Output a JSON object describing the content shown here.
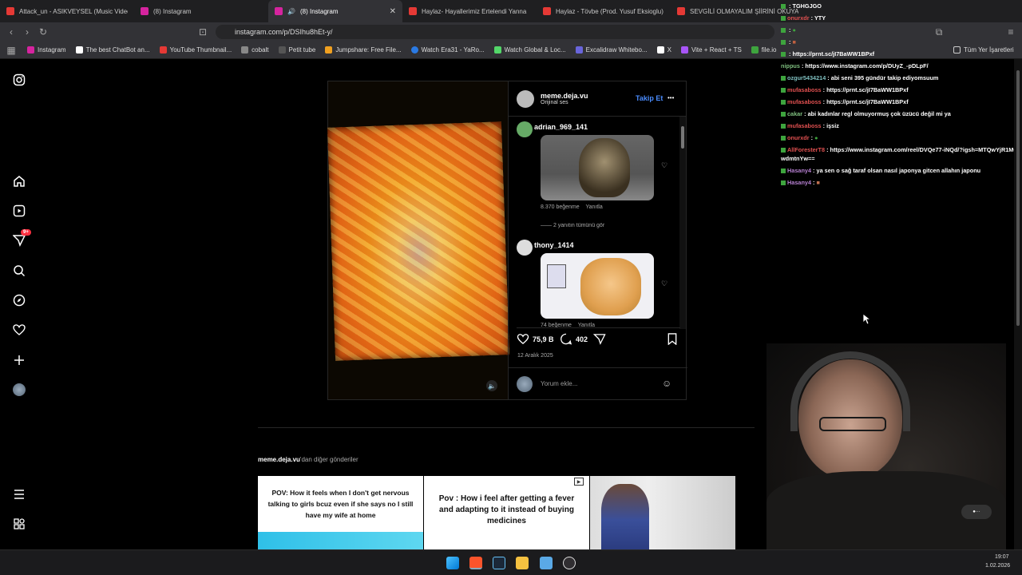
{
  "browser": {
    "tabs": [
      {
        "label": "Attack_un - ASIKVEYSEL (Music Video)",
        "color": "#e53935"
      },
      {
        "label": "(8) Instagram",
        "color": "#d6249f"
      },
      {
        "label": "(8) Instagram",
        "color": "#d6249f",
        "active": true
      },
      {
        "label": "Haylaz- Hayallerimiz Ertelendi Yanna",
        "color": "#e53935"
      },
      {
        "label": "Haylaz - Tövbe (Prod. Yusuf Eksioglu)",
        "color": "#e53935"
      },
      {
        "label": "SEVGİLİ OLMAYALIM ŞİİRİNİ OKUYAN",
        "color": "#e53935"
      }
    ],
    "url": "instagram.com/p/DSIhu8hEt-y/",
    "bookmarks": [
      {
        "label": "Instagram",
        "color": "#d6249f"
      },
      {
        "label": "The best ChatBot an...",
        "color": "#ffffff"
      },
      {
        "label": "YouTube Thumbnail...",
        "color": "#e53935"
      },
      {
        "label": "cobalt",
        "color": "#888888"
      },
      {
        "label": "Petit tube",
        "color": "#555555"
      },
      {
        "label": "Jumpshare: Free File...",
        "color": "#f0a020"
      },
      {
        "label": "Watch Era31 - YaRo...",
        "color": "#2a7ae4"
      },
      {
        "label": "Watch Global & Loc...",
        "color": "#53d769"
      },
      {
        "label": "Excalidraw Whitebo...",
        "color": "#6965db"
      },
      {
        "label": "X",
        "color": "#ffffff"
      },
      {
        "label": "Vite + React + TS",
        "color": "#a855f7"
      },
      {
        "label": "file.io",
        "color": "#3ea43e"
      }
    ],
    "all_bookmarks": "Tüm Yer İşaretleri"
  },
  "sidebar": {
    "notification_badge": "9+"
  },
  "post": {
    "username": "meme.deja.vu",
    "audio": "Orijinal ses",
    "follow": "Takip Et",
    "more": "•••",
    "comments": [
      {
        "user": "adrian_969_141",
        "likes": "8.370 beğenme",
        "reply": "Yanıtla",
        "see_replies": "2 yanıtın tümünü gör"
      },
      {
        "user": "thony_1414",
        "likes": "74 beğenme",
        "reply": "Yanıtla"
      }
    ],
    "like_count": "75,9 B",
    "comment_count": "402",
    "date": "12 Aralık 2025",
    "comment_placeholder": "Yorum ekle..."
  },
  "more_posts": {
    "owner": "meme.deja.vu",
    "suffix": "'dan diğer gönderiler",
    "tiles": [
      {
        "text": "POV: How it feels when I don't get nervous talking to girls bcuz even if she says no I still have my wife at home"
      },
      {
        "text": "Pov : How i feel after getting a fever and adapting to it instead of buying medicines"
      }
    ]
  },
  "chat": [
    {
      "user": "",
      "msg": "TGHGJGO",
      "color": "#e05050"
    },
    {
      "user": "onurxdr",
      "msg": "YTY",
      "color": "#e05050"
    },
    {
      "user": "",
      "msg": "",
      "color": "#e05050"
    },
    {
      "user": "",
      "msg": "",
      "color": "#e05050"
    },
    {
      "user": "",
      "msg": "https://prnt.sc/jI7BaWW1BPxf",
      "color": "#e05050"
    },
    {
      "user": "nippus",
      "msg": "https://www.instagram.com/p/DUyZ_-pDLpF/",
      "color": "#7fbf7f"
    },
    {
      "user": "ozgur5434214",
      "msg": "abi seni 395 gündür takip ediyomsuum",
      "color": "#7fbfbf"
    },
    {
      "user": "mufasaboss",
      "msg": "https://prnt.sc/jI7BaWW1BPxf",
      "color": "#e05050"
    },
    {
      "user": "mufasaboss",
      "msg": "https://prnt.sc/jI7BaWW1BPxf",
      "color": "#e05050"
    },
    {
      "user": "cakar",
      "msg": "abi kadınlar regl olmuyormuş çok üzücü değil mi ya",
      "color": "#7fbf7f"
    },
    {
      "user": "mufasaboss",
      "msg": "işsiz",
      "color": "#e05050"
    },
    {
      "user": "onurxdr",
      "msg": "",
      "color": "#e05050"
    },
    {
      "user": "AllForesterT8",
      "msg": "https://www.instagram.com/reel/DVQe77-iNQd/?igsh=MTQwYjR1MGtwdmtnYw==",
      "color": "#e05050"
    },
    {
      "user": "Hasany4",
      "msg": "ya sen o sağ taraf olsan nasıl japonya gitcen allahın japonu",
      "color": "#b57fd0"
    },
    {
      "user": "Hasany4",
      "msg": "",
      "color": "#b57fd0"
    }
  ],
  "taskbar": {
    "time": "19:07",
    "date": "1.02.2026"
  }
}
